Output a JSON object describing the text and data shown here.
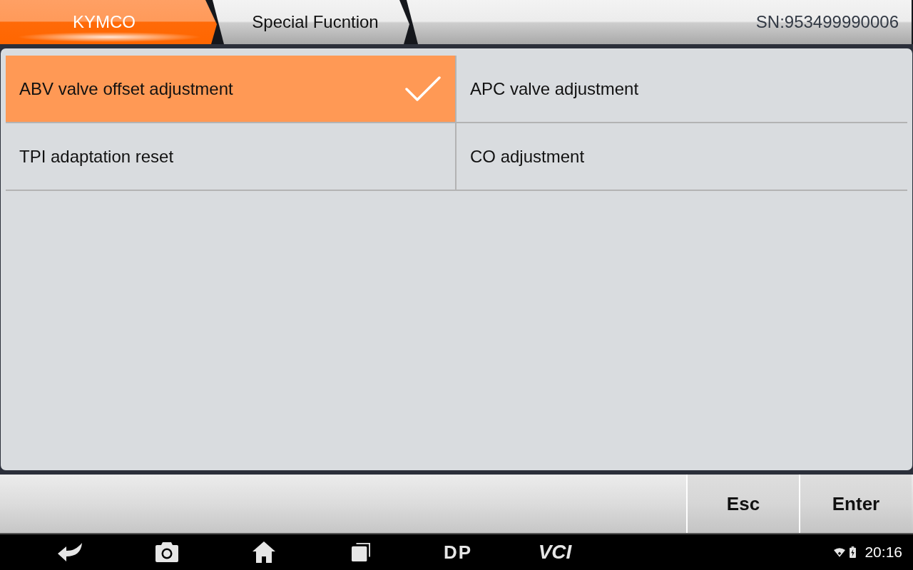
{
  "breadcrumb": [
    {
      "label": "KYMCO",
      "selected": true
    },
    {
      "label": "Special Fucntion",
      "selected": false
    }
  ],
  "serial_number": "SN:953499990006",
  "functions": [
    {
      "label": "ABV valve offset adjustment",
      "selected": true
    },
    {
      "label": "APC valve adjustment",
      "selected": false
    },
    {
      "label": "TPI adaptation reset",
      "selected": false
    },
    {
      "label": "CO adjustment",
      "selected": false
    }
  ],
  "buttons": [
    "Esc",
    "Enter"
  ],
  "nav_bar": {
    "items": [
      {
        "kind": "back"
      },
      {
        "kind": "camera"
      },
      {
        "kind": "home"
      },
      {
        "kind": "recents"
      },
      {
        "kind": "logo",
        "label": "DP"
      },
      {
        "kind": "logo",
        "label": "VCI"
      }
    ],
    "time": "20:16"
  }
}
